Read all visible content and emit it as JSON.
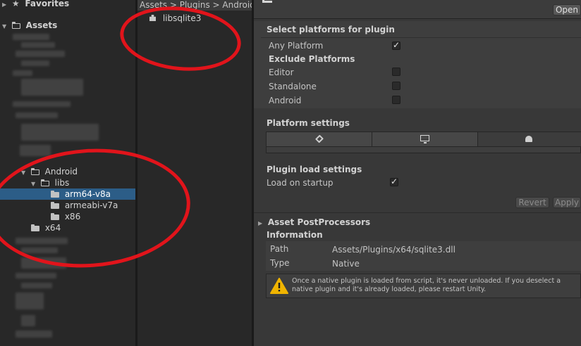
{
  "tree": {
    "favorites_label": "Favorites",
    "assets_label": "Assets",
    "android_label": "Android",
    "libs_label": "libs",
    "arm64_label": "arm64-v8a",
    "armeabi_label": "armeabi-v7a",
    "x86_label": "x86",
    "x64_label": "x64"
  },
  "files": {
    "breadcrumb": "Assets > Plugins > Android",
    "item_label": "libsqlite3"
  },
  "inspector": {
    "open_label": "Open",
    "select_platforms_title": "Select platforms for plugin",
    "any_platform_label": "Any Platform",
    "exclude_platforms_title": "Exclude Platforms",
    "exclude_items": [
      "Editor",
      "Standalone",
      "Android"
    ],
    "platform_settings_title": "Platform settings",
    "plugin_load_title": "Plugin load settings",
    "load_on_startup_label": "Load on startup",
    "revert_label": "Revert",
    "apply_label": "Apply",
    "postprocessors_label": "Asset PostProcessors",
    "information_title": "Information",
    "path_label": "Path",
    "path_value": "Assets/Plugins/x64/sqlite3.dll",
    "type_label": "Type",
    "type_value": "Native",
    "warning_text": "Once a native plugin is loaded from script, it's never unloaded. If you deselect a native plugin and it's already loaded, please restart Unity."
  },
  "icons": {
    "warning": "warning-icon",
    "standalone": "monitor-icon",
    "android": "android-icon",
    "default": "unity-icon"
  },
  "colors": {
    "selection": "#2c5d87",
    "annotation": "#e1141b",
    "warning": "#f0b400"
  }
}
